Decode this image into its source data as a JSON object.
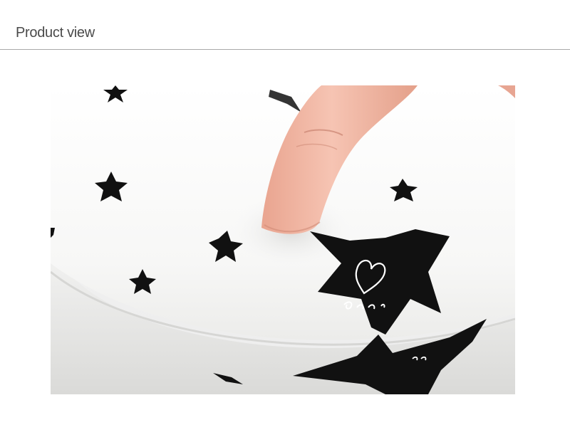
{
  "header": {
    "title": "Product view"
  },
  "photo": {
    "subject": "pillow-with-stars-and-finger",
    "colors": {
      "background": "#f2f2f2",
      "fabric": "#fbfbfa",
      "fabric_shadow": "#e6e6e4",
      "star": "#111111",
      "skin": "#f0b6a4",
      "skin_shadow": "#d98f7c",
      "rule": "#a9a9a9",
      "title": "#4a4a4a"
    }
  }
}
